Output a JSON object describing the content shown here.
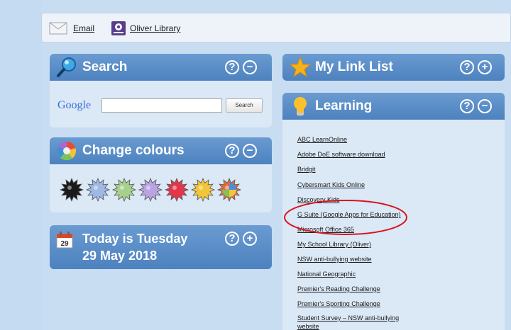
{
  "topbar": {
    "email_label": "Email",
    "library_label": "Oliver Library"
  },
  "search_panel": {
    "title": "Search",
    "google_wordmark": "Google",
    "input_value": "",
    "search_button": "Search"
  },
  "colours_panel": {
    "title": "Change colours",
    "swatches": [
      "black",
      "blue",
      "green",
      "purple",
      "red",
      "orange",
      "multicolour"
    ],
    "swatch_colors": [
      "#1a1a1a",
      "#9fb9e6",
      "#a8d08d",
      "#b9a3e3",
      "#e3364a",
      "#f2c63a",
      "#e46b3c"
    ]
  },
  "date_panel": {
    "day_number": "29",
    "line1": "Today is Tuesday",
    "line2": "29 May 2018"
  },
  "mylinks_panel": {
    "title": "My Link List"
  },
  "learning_panel": {
    "title": "Learning",
    "links": [
      "ABC LearnOnline",
      "Adobe DoE software download",
      "Bridgit",
      "Cybersmart Kids Online",
      "Discovery Kids",
      "G Suite (Google Apps for Education)",
      "Microsoft Office 365",
      "My School Library (Oliver)",
      "NSW anti-bullying website",
      "National Geographic",
      "Premier's Reading Challenge",
      "Premier's Sporting Challenge",
      "Student Survey – NSW anti-bullying",
      "website"
    ]
  },
  "help_glyph": "?",
  "collapse_glyph": "−",
  "expand_glyph": "+",
  "colors": {
    "panel_header": "#5a8cc8",
    "panel_body": "#dbe8f6",
    "highlight_ellipse": "#d9141e"
  }
}
